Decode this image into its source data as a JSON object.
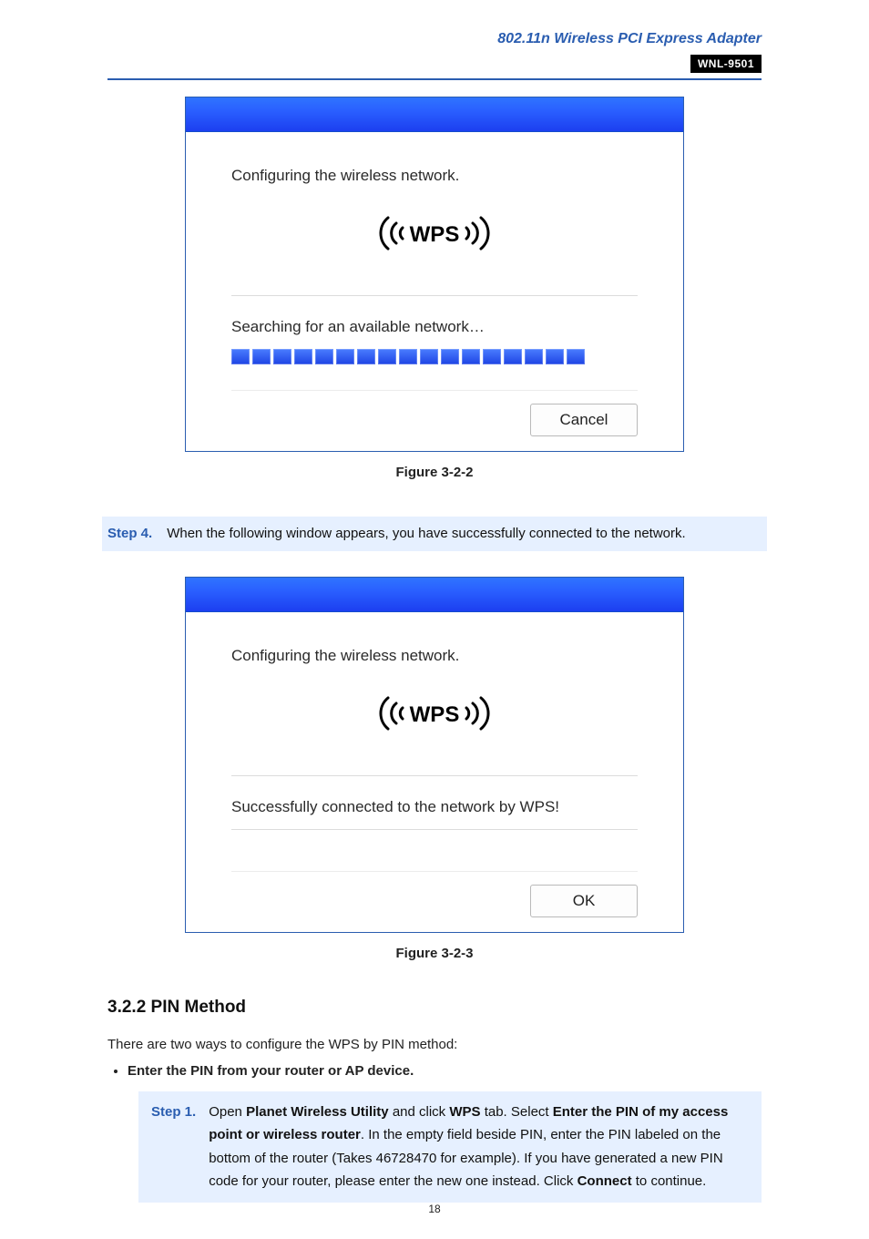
{
  "header": {
    "title": "802.11n Wireless PCI Express Adapter",
    "badge": "WNL-9501"
  },
  "dialog1": {
    "message": "Configuring the wireless network.",
    "logo_text": "WPS",
    "status": "Searching for an available network…",
    "progress_segments": 17,
    "cancel": "Cancel"
  },
  "figure1_caption": "Figure 3-2-2",
  "step4": {
    "label": "Step 4.",
    "text": "When the following window appears, you have successfully connected to the network."
  },
  "dialog2": {
    "message": "Configuring the wireless network.",
    "logo_text": "WPS",
    "status": "Successfully connected to the network by WPS!",
    "ok": "OK"
  },
  "figure2_caption": "Figure 3-2-3",
  "section": {
    "heading": "3.2.2  PIN Method",
    "intro": "There are two ways to configure the WPS by PIN method:",
    "bullet1": "Enter the PIN from your router or AP device."
  },
  "inner_step1": {
    "label": "Step 1.",
    "t1": "Open ",
    "b1": "Planet Wireless Utility",
    "t2": " and click ",
    "b2": "WPS",
    "t3": " tab. Select ",
    "b3": "Enter the PIN of my access point or wireless router",
    "t4": ". In the empty field beside PIN, enter the PIN labeled on the bottom of the router (Takes 46728470 for example). If you have generated a new PIN code for your router, please enter the new one instead. Click ",
    "b4": "Connect",
    "t5": " to continue."
  },
  "page_number": "18"
}
